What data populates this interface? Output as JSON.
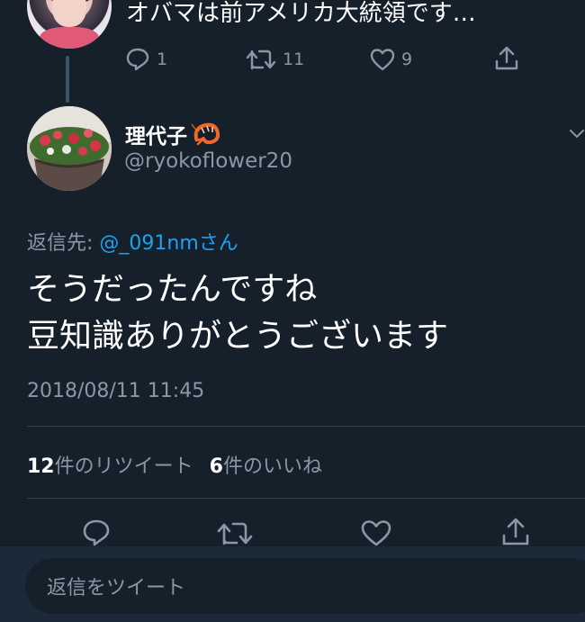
{
  "parent_tweet": {
    "text": "オバマは前アメリカ大統領です…",
    "replies": "1",
    "retweets": "11",
    "likes": "9"
  },
  "tweet": {
    "display_name": "理代子",
    "name_emoji_icon": "shrimp-icon",
    "handle": "@ryokoflower20",
    "reply_prefix": "返信先:",
    "reply_mention": "@_091nmさん",
    "body_line1": "そうだったんですね",
    "body_line2": "豆知識ありがとうございます",
    "timestamp": "2018/08/11 11:45"
  },
  "stats": {
    "retweet_count": "12",
    "retweet_label": "件のリツイート",
    "like_count": "6",
    "like_label": "件のいいね"
  },
  "reply_bar": {
    "placeholder": "返信をツイート"
  },
  "colors": {
    "background": "#15202b",
    "accent": "#1da1f2",
    "secondary_text": "#8899a6",
    "divider": "#38444d"
  }
}
